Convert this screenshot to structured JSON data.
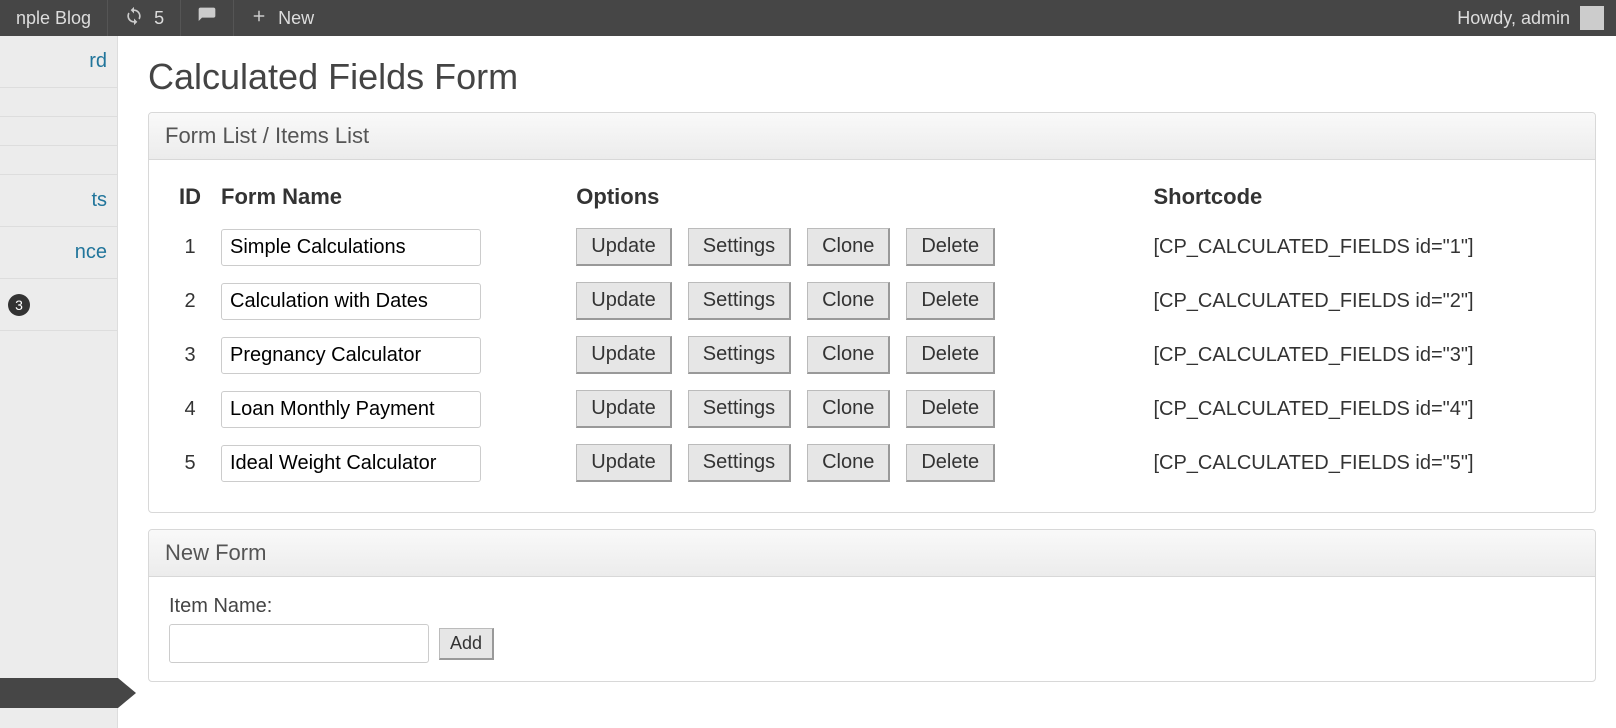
{
  "adminbar": {
    "site_title_fragment": "nple Blog",
    "updates_count": "5",
    "new_label": "New",
    "howdy": "Howdy, admin"
  },
  "sidebar": {
    "items": [
      "rd",
      "",
      "",
      "",
      "ts",
      "nce"
    ],
    "plugin_badge": "3"
  },
  "page": {
    "title": "Calculated Fields Form"
  },
  "listpanel": {
    "header": "Form List / Items List",
    "columns": {
      "id": "ID",
      "name": "Form Name",
      "options": "Options",
      "shortcode": "Shortcode"
    },
    "buttons": {
      "update": "Update",
      "settings": "Settings",
      "clone": "Clone",
      "delete": "Delete"
    },
    "rows": [
      {
        "id": "1",
        "name": "Simple Calculations",
        "shortcode": "[CP_CALCULATED_FIELDS id=\"1\"]"
      },
      {
        "id": "2",
        "name": "Calculation with Dates",
        "shortcode": "[CP_CALCULATED_FIELDS id=\"2\"]"
      },
      {
        "id": "3",
        "name": "Pregnancy Calculator",
        "shortcode": "[CP_CALCULATED_FIELDS id=\"3\"]"
      },
      {
        "id": "4",
        "name": "Loan Monthly Payment",
        "shortcode": "[CP_CALCULATED_FIELDS id=\"4\"]"
      },
      {
        "id": "5",
        "name": "Ideal Weight Calculator",
        "shortcode": "[CP_CALCULATED_FIELDS id=\"5\"]"
      }
    ]
  },
  "newform": {
    "header": "New Form",
    "label": "Item Name:",
    "add": "Add"
  }
}
